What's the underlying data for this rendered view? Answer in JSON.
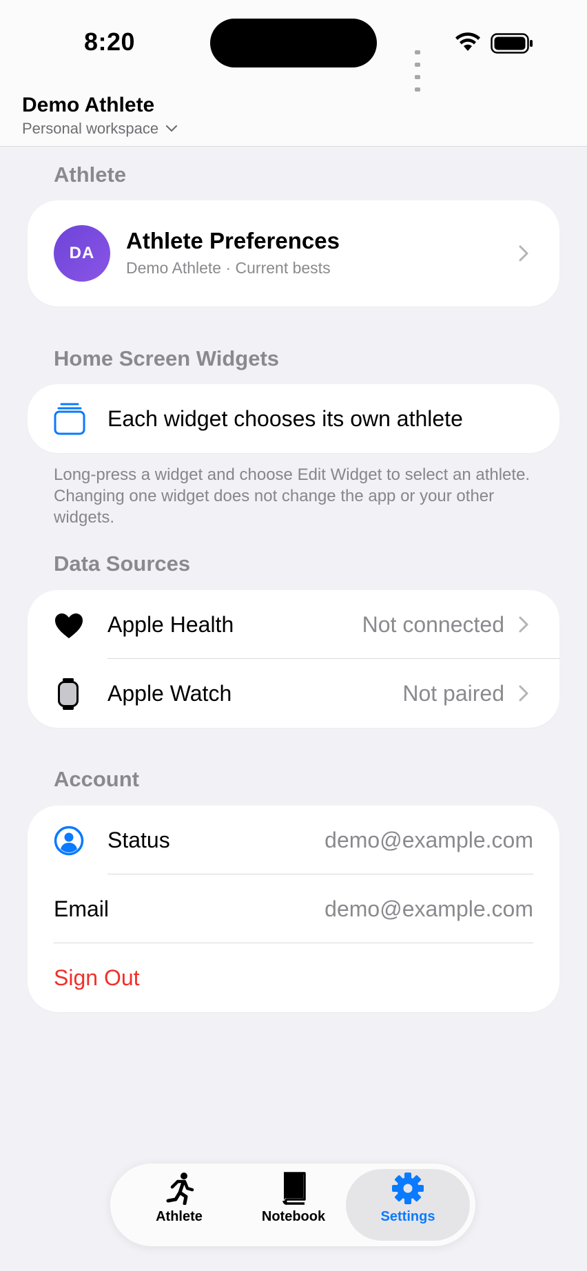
{
  "status_bar": {
    "time": "8:20"
  },
  "header": {
    "title": "Demo Athlete",
    "workspace": "Personal workspace"
  },
  "athlete_section": {
    "label": "Athlete",
    "preferences": {
      "initials": "DA",
      "title": "Athlete Preferences",
      "subtitle": "Demo Athlete · Current bests"
    }
  },
  "widgets_section": {
    "label": "Home Screen Widgets",
    "row_label": "Each widget chooses its own athlete",
    "footnote": "Long-press a widget and choose Edit Widget to select an athlete. Changing one widget does not change the app or your other widgets."
  },
  "data_sources": {
    "label": "Data Sources",
    "items": [
      {
        "label": "Apple Health",
        "value": "Not connected",
        "icon": "heart-icon"
      },
      {
        "label": "Apple Watch",
        "value": "Not paired",
        "icon": "watch-icon"
      }
    ]
  },
  "account": {
    "label": "Account",
    "status_label": "Status",
    "status_value": "demo@example.com",
    "email_label": "Email",
    "email_value": "demo@example.com",
    "sign_out": "Sign Out"
  },
  "tab_bar": {
    "tabs": [
      {
        "label": "Athlete",
        "icon": "runner-icon",
        "selected": false
      },
      {
        "label": "Notebook",
        "icon": "book-icon",
        "selected": false
      },
      {
        "label": "Settings",
        "icon": "gear-icon",
        "selected": true
      }
    ]
  },
  "colors": {
    "accent": "#0a7aff",
    "destructive": "#f0302a",
    "avatar": "#7049dc"
  }
}
